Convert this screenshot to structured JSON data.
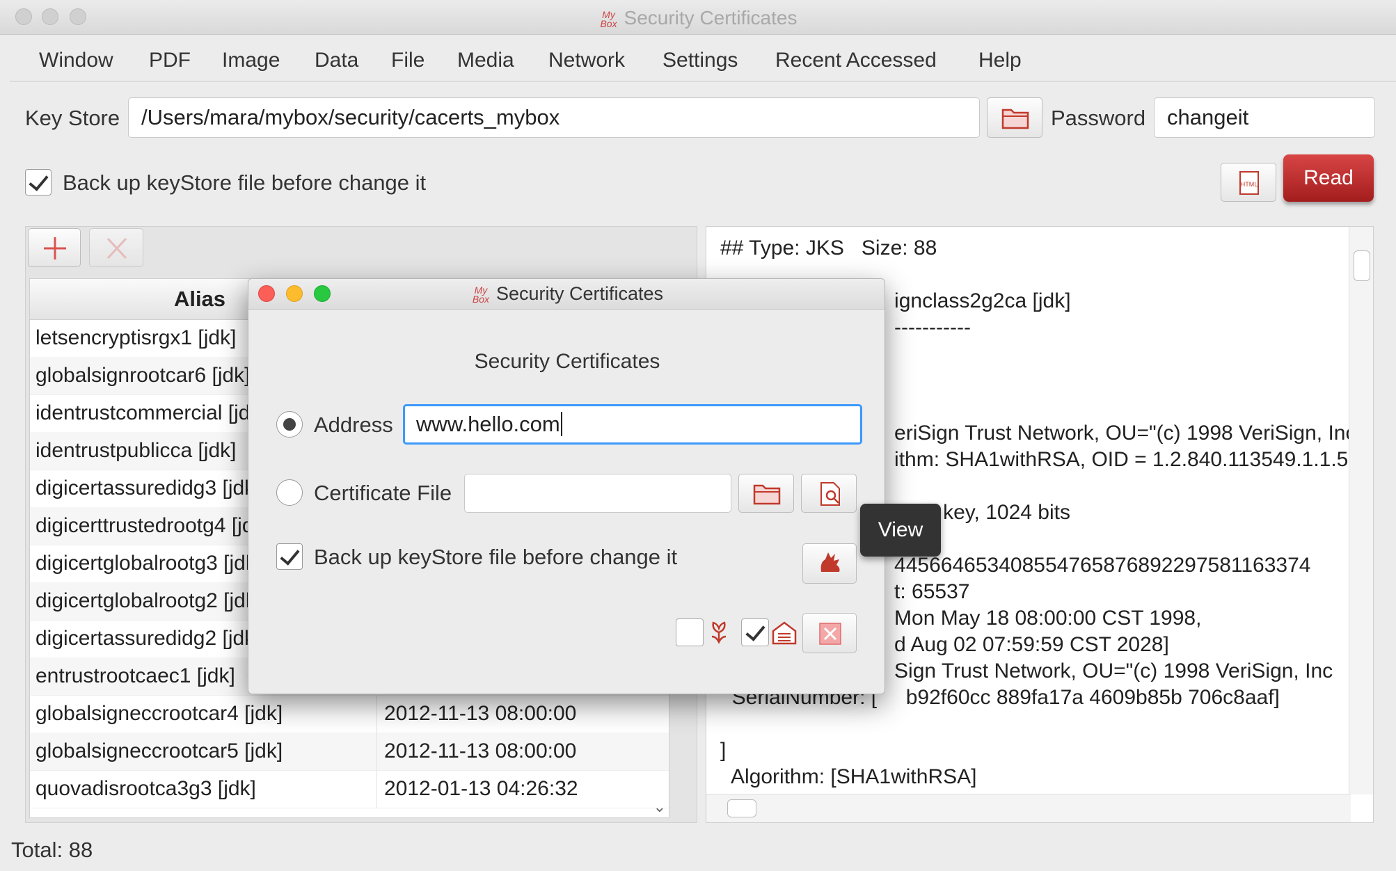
{
  "window": {
    "title": "Security Certificates",
    "logo_text": "My Box"
  },
  "menu": [
    "Window",
    "PDF",
    "Image",
    "Data",
    "File",
    "Media",
    "Network",
    "Settings",
    "Recent Accessed",
    "Help"
  ],
  "keystore": {
    "label": "Key Store",
    "path": "/Users/mara/mybox/security/cacerts_mybox",
    "password_label": "Password",
    "password_value": "changeit",
    "backup_label": "Back up keyStore file before change it",
    "backup_checked": true,
    "html_icon_text": "HTML",
    "read_label": "Read"
  },
  "table": {
    "headers": [
      "Alias",
      "",
      ""
    ],
    "rows": [
      [
        "letsencryptisrgx1 [jdk]",
        "",
        ""
      ],
      [
        "globalsignrootcar6 [jdk]",
        "",
        ""
      ],
      [
        "identrustcommercial [jdk]",
        "",
        ""
      ],
      [
        "identrustpublicca [jdk]",
        "",
        ""
      ],
      [
        "digicertassuredidg3 [jdk]",
        "",
        ""
      ],
      [
        "digicerttrustedrootg4 [jdk]",
        "",
        ""
      ],
      [
        "digicertglobalrootg3 [jdk]",
        "",
        ""
      ],
      [
        "digicertglobalrootg2 [jdk]",
        "",
        ""
      ],
      [
        "digicertassuredidg2 [jdk]",
        "",
        ""
      ],
      [
        "entrustrootcaec1 [jdk]",
        "",
        ""
      ],
      [
        "globalsigneccrootcar4 [jdk]",
        "2012-11-13 08:00:00",
        ""
      ],
      [
        "globalsigneccrootcar5 [jdk]",
        "2012-11-13 08:00:00",
        ""
      ],
      [
        "quovadisrootca3g3 [jdk]",
        "2012-01-13 04:26:32",
        ""
      ]
    ]
  },
  "details_lines": [
    "## Type: JKS   Size: 88",
    "",
    "                              ignclass2g2ca [jdk]",
    "                              -----------",
    "",
    "",
    "",
    "                              eriSign Trust Network, OU=\"(c) 1998 VeriSign, Inc",
    "                              ithm: SHA1withRSA, OID = 1.2.840.113549.1.1.5",
    "",
    "                              ublic key, 1024 bits",
    "",
    "                              445664653408554765876892297581163374",
    "                              t: 65537",
    "                              Mon May 18 08:00:00 CST 1998,",
    "                              d Aug 02 07:59:59 CST 2028]",
    "                              Sign Trust Network, OU=\"(c) 1998 VeriSign, Inc",
    "  SerialNumber: [     b92f60cc 889fa17a 4609b85b 706c8aaf]",
    "",
    "]",
    "  Algorithm: [SHA1withRSA]"
  ],
  "status": {
    "total": "Total: 88"
  },
  "dialog": {
    "title": "Security Certificates",
    "heading": "Security Certificates",
    "address_label": "Address",
    "address_value": "www.hello.com",
    "address_selected": true,
    "cert_file_label": "Certificate File",
    "cert_file_value": "",
    "backup_label": "Back up keyStore file before change it",
    "backup_checked": true
  },
  "tooltip": {
    "text": "View"
  },
  "colors": {
    "accent_red": "#c0392b",
    "focus_blue": "#3b99fc",
    "close_red": "#fc5f57",
    "min_yellow": "#fdbc2e",
    "max_green": "#28c840"
  },
  "icons": [
    "folder-icon",
    "add-icon",
    "delete-icon",
    "html-icon",
    "file-view-icon",
    "hand-icon",
    "flower-icon",
    "house-icon",
    "close-icon"
  ]
}
